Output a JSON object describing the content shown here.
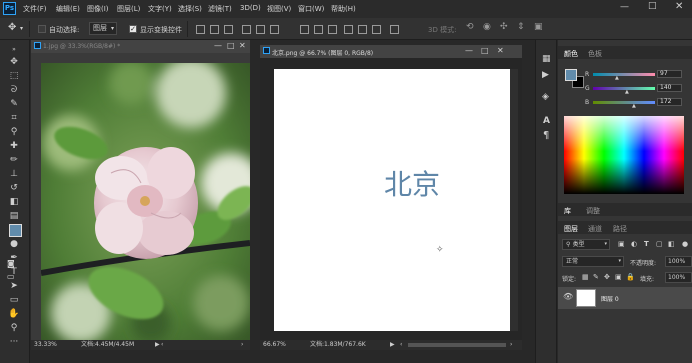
{
  "menubar": {
    "logo": "Ps",
    "items": [
      "文件(F)",
      "编辑(E)",
      "图像(I)",
      "图层(L)",
      "文字(Y)",
      "选择(S)",
      "滤镜(T)",
      "3D(D)",
      "视图(V)",
      "窗口(W)",
      "帮助(H)"
    ]
  },
  "options": {
    "auto_select_label": "自动选择:",
    "auto_select_value": "图层",
    "show_transform_label": "显示变换控件",
    "mode_3d_label": "3D 模式:"
  },
  "doc1": {
    "tab_title": "1.jpg @ 33.3%(RGB/8#) *",
    "zoom": "33.33%",
    "doc_info": "文档:4.45M/4.45M"
  },
  "doc2": {
    "tab_title": "北京.png @ 66.7% (图层 0, RGB/8)",
    "canvas_text": "北京",
    "text_color": "#5f86a8",
    "zoom": "66.67%",
    "doc_info": "文档:1.83M/767.6K"
  },
  "color_panel": {
    "tab_active": "颜色",
    "tab_other": "色板",
    "r_label": "R",
    "g_label": "G",
    "b_label": "B",
    "r_value": "97",
    "g_value": "140",
    "b_value": "172",
    "foreground": "#618cac",
    "background": "#000000"
  },
  "library_tabs": {
    "libraries": "库",
    "adjustments": "调整"
  },
  "layers_panel": {
    "tabs": [
      "图层",
      "通道",
      "路径"
    ],
    "filter_label": "类型",
    "blend_mode": "正常",
    "opacity_label": "不透明度:",
    "opacity_value": "100%",
    "lock_label": "锁定:",
    "fill_label": "填充:",
    "fill_value": "100%",
    "layer_name": "图层 0"
  }
}
